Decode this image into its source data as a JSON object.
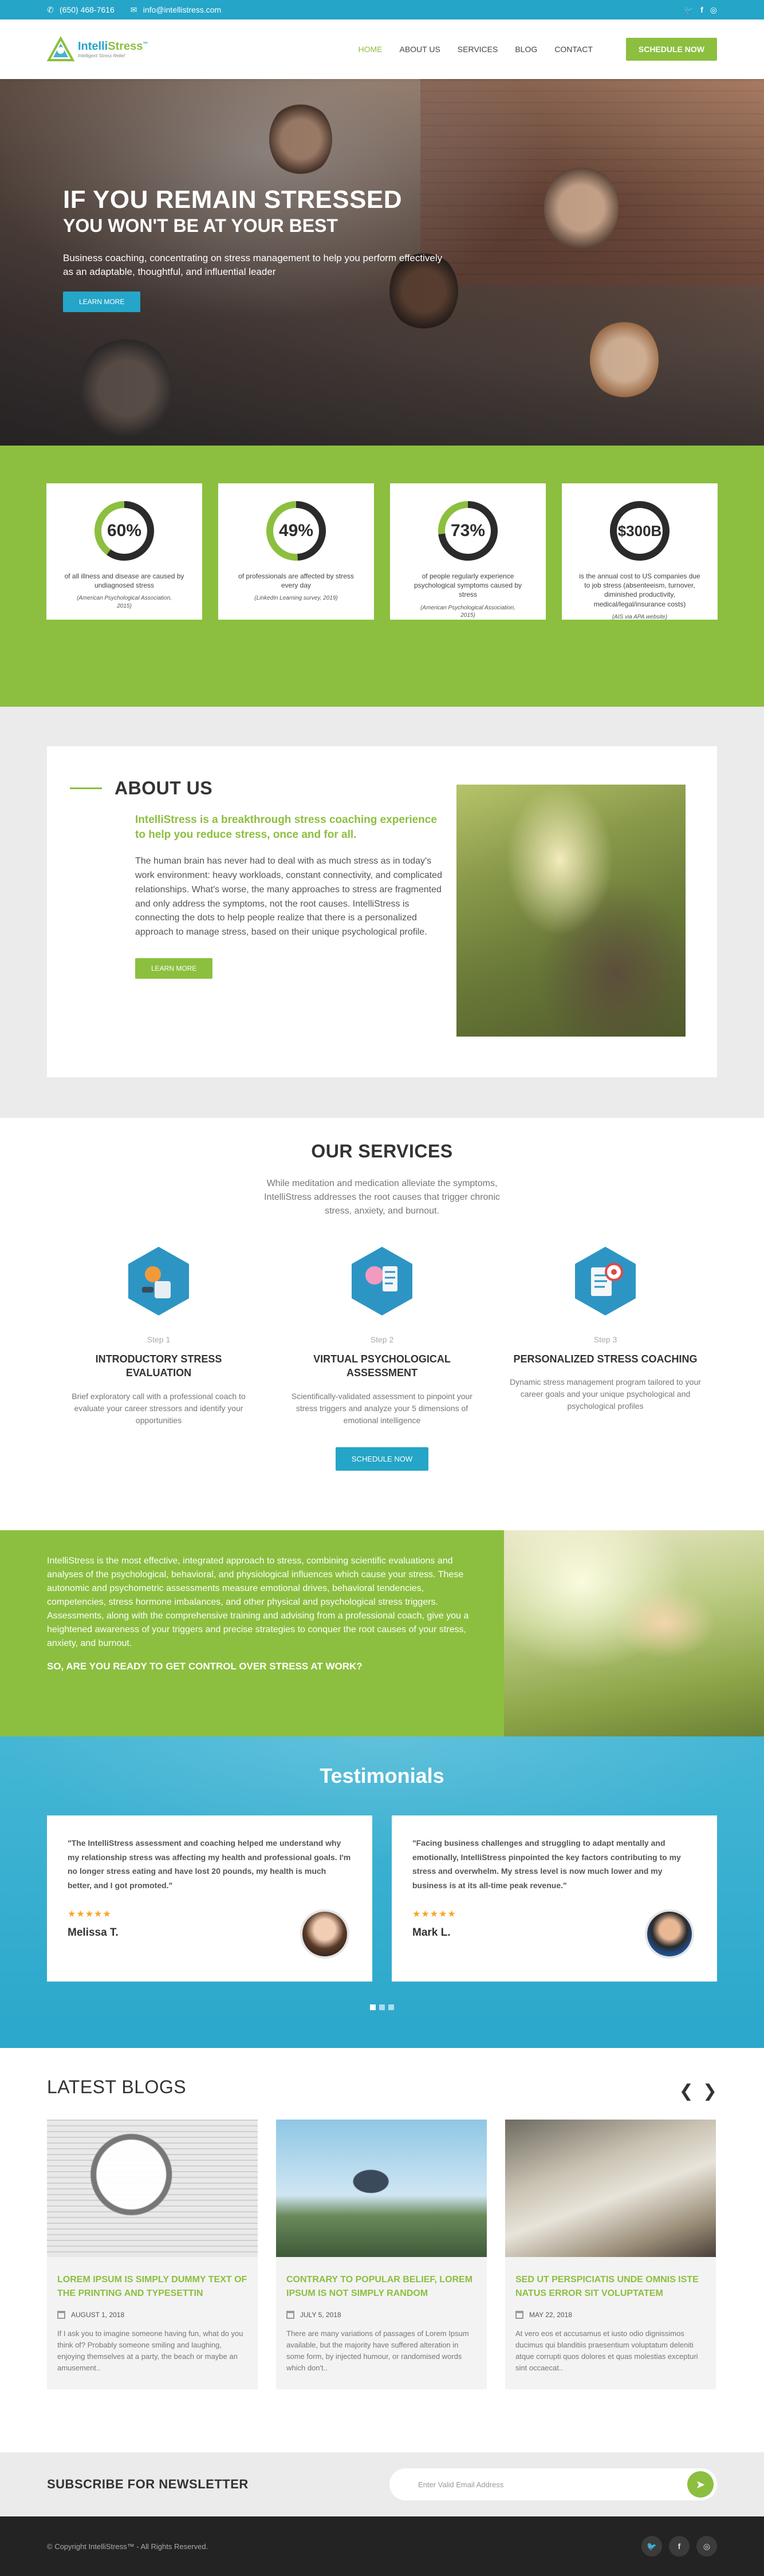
{
  "topbar": {
    "phone": "(650) 468-7616",
    "email": "info@intellistress.com",
    "social": [
      "twitter-icon",
      "facebook-icon",
      "instagram-icon"
    ]
  },
  "header": {
    "logo_name_a": "Intelli",
    "logo_name_b": "Stress",
    "logo_tm": "™",
    "logo_tagline": "Intelligent Stress Relief",
    "nav": [
      "HOME",
      "ABOUT US",
      "SERVICES",
      "BLOG",
      "CONTACT"
    ],
    "active_nav": "HOME",
    "cta": "SCHEDULE NOW"
  },
  "hero": {
    "title": "IF YOU REMAIN STRESSED",
    "subtitle": "YOU WON'T BE AT YOUR BEST",
    "text": "Business coaching, concentrating on stress management to help you perform effectively as an adaptable, thoughtful, and influential leader",
    "button": "LEARN MORE"
  },
  "stats": [
    {
      "value": "60%",
      "percent": 60,
      "text": "of all illness and disease are caused by undiagnosed stress",
      "source": "(American Psychological Association, 2015)"
    },
    {
      "value": "49%",
      "percent": 49,
      "text": "of professionals are affected by stress every day",
      "source": "(LinkedIn Learning survey, 2019)"
    },
    {
      "value": "73%",
      "percent": 73,
      "text": "of people regularly experience psychological symptoms caused by stress",
      "source": "(American Psychological Association, 2015)"
    },
    {
      "value": "$300B",
      "percent": 100,
      "text": "is the annual cost to US companies due to job stress (absenteeism, turnover, diminished productivity, medical/legal/insurance costs)",
      "source": "(AIS via APA website)"
    }
  ],
  "about": {
    "title": "ABOUT US",
    "lead": "IntelliStress is a breakthrough stress coaching experience to help you reduce stress, once and for all.",
    "body": "The human brain has never had to deal with as much stress as in today's work environment: heavy workloads, constant connectivity, and complicated relationships. What's worse, the many approaches to stress are fragmented and only address the symptoms, not the root causes. IntelliStress is connecting the dots to help people realize that there is a personalized approach to manage stress, based on their unique psychological profile.",
    "button": "LEARN MORE"
  },
  "services": {
    "title": "OUR SERVICES",
    "sub": "While meditation and medication alleviate the symptoms, IntelliStress addresses the root causes that trigger chronic stress, anxiety, and burnout.",
    "steps": [
      {
        "num": "Step 1",
        "title": "INTRODUCTORY STRESS EVALUATION",
        "desc": "Brief exploratory call with a professional coach to evaluate your career stressors and identify your opportunities"
      },
      {
        "num": "Step 2",
        "title": "VIRTUAL PSYCHOLOGICAL ASSESSMENT",
        "desc": "Scientifically-validated assessment to pinpoint your stress triggers and analyze your 5 dimensions of emotional intelligence"
      },
      {
        "num": "Step 3",
        "title": "PERSONALIZED STRESS COACHING",
        "desc": "Dynamic stress management program tailored to your career goals and your unique psychological and psychological profiles"
      }
    ],
    "button": "SCHEDULE NOW"
  },
  "cta": {
    "text": "IntelliStress is the most effective, integrated approach to stress, combining scientific evaluations and analyses of the psychological, behavioral, and physiological influences which cause your stress. These autonomic and psychometric assessments measure emotional drives, behavioral tendencies, competencies, stress hormone imbalances, and other physical and psychological stress triggers. Assessments, along with the comprehensive training and advising from a professional coach, give you a heightened awareness of your triggers and precise strategies to conquer the root causes of your stress, anxiety, and burnout.",
    "question": "SO, ARE YOU READY TO GET CONTROL OVER STRESS AT WORK?"
  },
  "testimonials": {
    "title": "Testimonials",
    "items": [
      {
        "quote": "\"The IntelliStress assessment and coaching helped me understand why my relationship stress was affecting my health and professional goals. I'm no longer stress eating and have lost 20 pounds, my health is much better, and I got promoted.\"",
        "stars": "★★★★★",
        "name": "Melissa T."
      },
      {
        "quote": "\"Facing business challenges and struggling to adapt mentally and emotionally, IntelliStress pinpointed the key factors contributing to my stress and overwhelm. My stress level is now much lower and my business is at its all-time peak revenue.\"",
        "stars": "★★★★★",
        "name": "Mark L."
      }
    ]
  },
  "blogs": {
    "title": "LATEST BLOGS",
    "prev": "❮",
    "next": "❯",
    "items": [
      {
        "title": "LOREM IPSUM IS SIMPLY DUMMY TEXT OF THE PRINTING AND TYPESETTIN",
        "date": "AUGUST 1, 2018",
        "desc": "If I ask you to imagine someone having fun, what do you think of? Probably someone smiling and laughing, enjoying themselves at a party, the beach or maybe an amusement.."
      },
      {
        "title": "CONTRARY TO POPULAR BELIEF, LOREM IPSUM IS NOT SIMPLY RANDOM",
        "date": "JULY 5, 2018",
        "desc": "There are many variations of passages of Lorem Ipsum available, but the majority have suffered alteration in some form, by injected humour, or randomised words which don't.."
      },
      {
        "title": "SED UT PERSPICIATIS UNDE OMNIS ISTE NATUS ERROR SIT VOLUPTATEM",
        "date": "MAY 22, 2018",
        "desc": "At vero eos et accusamus et iusto odio dignissimos ducimus qui blanditiis praesentium voluptatum deleniti atque corrupti quos dolores et quas molestias excepturi sint occaecat.."
      }
    ]
  },
  "newsletter": {
    "title": "SUBSCRIBE FOR NEWSLETTER",
    "placeholder": "Enter Valid Email Address",
    "send": "➤"
  },
  "footer": {
    "copyright": "© Copyright IntelliStress™ - All Rights Reserved.",
    "social": [
      "twitter-icon",
      "facebook-icon",
      "instagram-icon"
    ]
  },
  "colors": {
    "brand_blue": "#25a5c8",
    "brand_green": "#8cbf3f",
    "dark": "#232323"
  }
}
